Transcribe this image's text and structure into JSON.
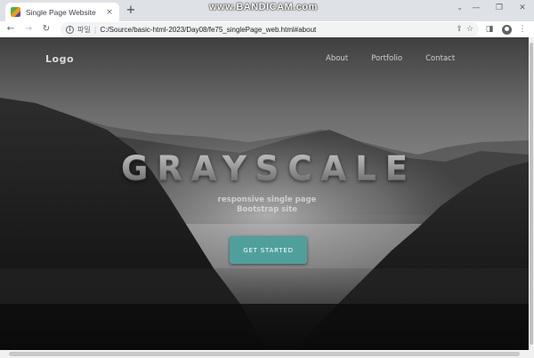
{
  "browser": {
    "tab_title": "Single Page Website",
    "tab_close": "×",
    "new_tab": "+",
    "address_prefix": "파일",
    "address_separator": "|",
    "url": "C:/Source/basic-html-2023/Day08/fe75_singlePage_web.html#about",
    "watermark": "www.BANDICAM.com",
    "icons": {
      "back": "arrow-left-icon",
      "forward": "arrow-right-icon",
      "reload": "reload-icon",
      "info": "info-icon",
      "share": "share-icon",
      "bookmark": "star-icon",
      "sidepanel": "side-panel-icon",
      "profile": "profile-icon",
      "menu": "kebab-menu-icon"
    }
  },
  "site": {
    "logo": "Logo",
    "nav": [
      "About",
      "Portfolio",
      "Contact"
    ],
    "hero_title": "GRAYSCALE",
    "hero_subtitle": "responsive single page Bootstrap site",
    "cta_label": "GET STARTED"
  },
  "colors": {
    "cta": "#4fa09c",
    "hero_background": "#2a2a2a"
  }
}
